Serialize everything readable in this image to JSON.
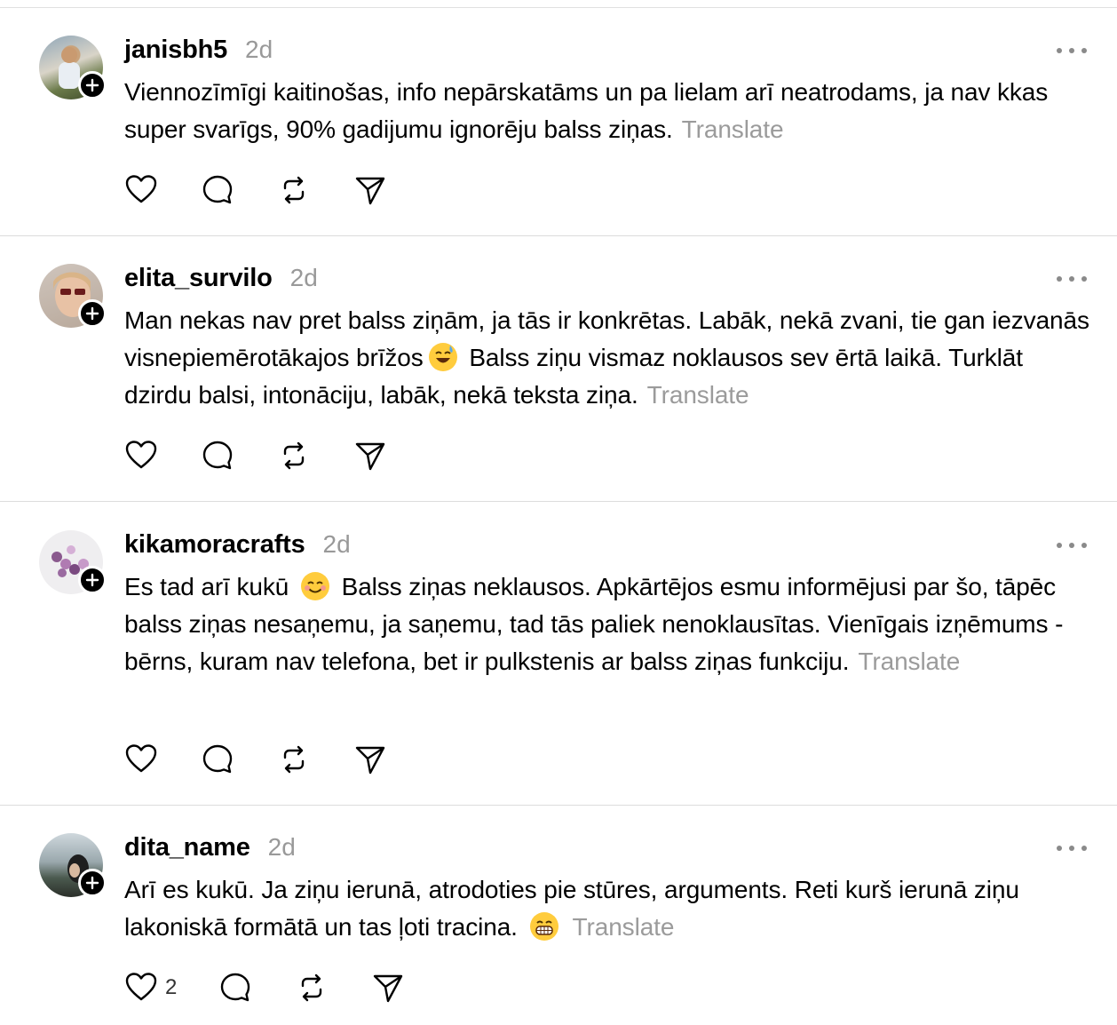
{
  "posts": [
    {
      "username": "janisbh5",
      "time": "2d",
      "text": "Viennozīmīgi kaitinošas, info nepārskatāms un pa lielam arī neatrodams, ja nav kkas super svarīgs, 90% gadijumu ignorēju balss ziņas.",
      "translate": "Translate",
      "likes": ""
    },
    {
      "username": "elita_survilo",
      "time": "2d",
      "text_a": "Man nekas nav pret balss ziņām, ja tās ir konkrētas. Labāk, nekā zvani, tie gan iezvanās visnepiemērotākajos brīžos",
      "emoji": "sweat-smile-emoji",
      "text_b": " Balss ziņu vismaz noklausos sev ērtā laikā. Turklāt dzirdu balsi, intonāciju, labāk, nekā teksta ziņa.",
      "translate": "Translate",
      "likes": ""
    },
    {
      "username": "kikamoracrafts",
      "time": "2d",
      "text_a": "Es tad arī kukū ",
      "emoji": "smiling-emoji",
      "text_b": " Balss ziņas neklausos. Apkārtējos esmu informējusi par šo, tāpēc balss ziņas nesaņemu, ja saņemu, tad tās paliek nenoklausītas. Vienīgais izņēmums - bērns, kuram nav telefona, bet ir pulkstenis ar balss ziņas funkciju.",
      "translate": "Translate",
      "likes": ""
    },
    {
      "username": "dita_name",
      "time": "2d",
      "text_a": "Arī es kukū. Ja ziņu ierunā, atrodoties pie stūres, arguments. Reti kurš ierunā ziņu lakoniskā formātā un tas ļoti tracina. ",
      "emoji": "grinning-emoji",
      "text_b": "",
      "translate": "Translate",
      "likes": "2"
    }
  ],
  "icons": {
    "like": "heart-icon",
    "reply": "comment-icon",
    "repost": "repost-icon",
    "share": "send-icon",
    "follow": "plus-icon",
    "more": "more-icon"
  }
}
